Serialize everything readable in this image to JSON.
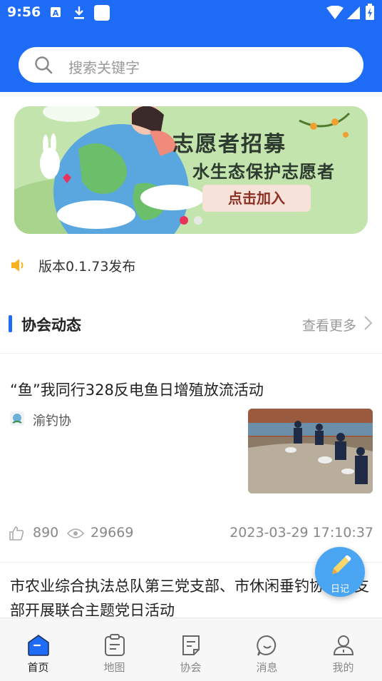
{
  "status_bar": {
    "time": "9:56"
  },
  "search": {
    "placeholder": "搜索关键字"
  },
  "banner": {
    "title": "志愿者招募",
    "subtitle": "水生态保护志愿者",
    "button": "点击加入",
    "active_index": 0,
    "count": 2
  },
  "notice": {
    "text": "版本0.1.73发布"
  },
  "section": {
    "title": "协会动态",
    "more": "查看更多"
  },
  "news": [
    {
      "title": "“鱼”我同行328反电鱼日增殖放流活动",
      "source": "渝钓协",
      "likes": "890",
      "views": "29669",
      "datetime": "2023-03-29 17:10:37"
    },
    {
      "title": "市农业综合执法总队第三党支部、市休闲垂钓协会党支部开展联合主题党日活动"
    }
  ],
  "fab": {
    "label": "日记"
  },
  "tabs": [
    {
      "label": "首页",
      "icon": "home-icon",
      "active": true
    },
    {
      "label": "地图",
      "icon": "map-icon",
      "active": false
    },
    {
      "label": "协会",
      "icon": "association-icon",
      "active": false
    },
    {
      "label": "消息",
      "icon": "message-icon",
      "active": false
    },
    {
      "label": "我的",
      "icon": "profile-icon",
      "active": false
    }
  ],
  "colors": {
    "primary": "#1e6cf5",
    "accent_dot": "#e8335d",
    "notice_icon": "#f5b21e"
  }
}
